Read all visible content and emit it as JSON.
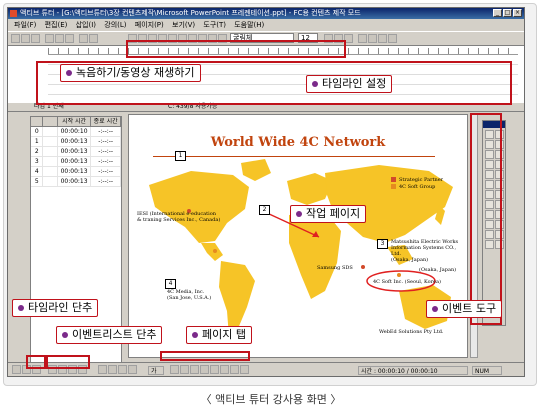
{
  "window": {
    "title": "액티브 튜터 - [G:\\액티브튜터\\3장 컨텐츠제작\\Microsoft PowerPoint 프레젠테이션.ppt] - FC용 컨텐츠 제작 모드",
    "menus": [
      "파일(F)",
      "편집(E)",
      "삽입(I)",
      "강의(L)",
      "페이지(P)",
      "보기(V)",
      "도구(T)",
      "도움말(H)"
    ],
    "font_name": "굴림체",
    "font_size": "12"
  },
  "status_line": {
    "page_label": "타임 1 번째",
    "time_label": "C:  439/8 사용가능"
  },
  "event_list": {
    "headers": [
      "",
      "",
      "시작 시간",
      "종료 시간"
    ],
    "rows": [
      {
        "num": "0",
        "start": "00:00:10",
        "end": "-:--:--"
      },
      {
        "num": "1",
        "start": "00:00:13",
        "end": "-:--:--"
      },
      {
        "num": "2",
        "start": "00:00:13",
        "end": "-:--:--"
      },
      {
        "num": "3",
        "start": "00:00:13",
        "end": "-:--:--"
      },
      {
        "num": "4",
        "start": "00:00:13",
        "end": "-:--:--"
      },
      {
        "num": "5",
        "start": "00:00:13",
        "end": "-:--:--"
      }
    ]
  },
  "slide": {
    "title": "World Wide 4C Network",
    "boxes": [
      "1",
      "2",
      "3",
      "4"
    ],
    "legend": [
      "Strategic Partner",
      "4C Soft Group"
    ],
    "labels": {
      "ieso": "IESI (International e-education\n& traning Services Inc., Canada)",
      "matsushita": "Matsushita Electric Works\nInformation Systems CO., Ltd.\n(Osaka, Japan)",
      "samsung": "Samsung SDS",
      "osaka": "(Osaka, Japan)",
      "korea": "4C Soft Inc. (Seoul, Korea)",
      "media": "4C Media, Inc.\n(San Jose, U.S.A.)",
      "webed": "WebEd Solutions Pty Ltd."
    }
  },
  "status_bar": {
    "time_text": "시간 : 00:00:10 / 00:00:10",
    "num_text": "NUM",
    "ime": "가"
  },
  "callouts": {
    "record": "녹음하기/동영상 재생하기",
    "timeline": "타임라인 설정",
    "work_page": "작업 페이지",
    "timeline_btn": "타임라인 단추",
    "event_list_btn": "이벤트리스트 단추",
    "page_tab": "페이지 탭",
    "event_tool": "이벤트 도구"
  },
  "caption": "〈 액티브 튜터 강사용 화면 〉",
  "colors": {
    "annotation_red": "#c0121b",
    "map_fill": "#f6c427",
    "title_orange": "#c1440e",
    "partner_red": "#d2492a",
    "group_orange": "#e58a1f"
  }
}
